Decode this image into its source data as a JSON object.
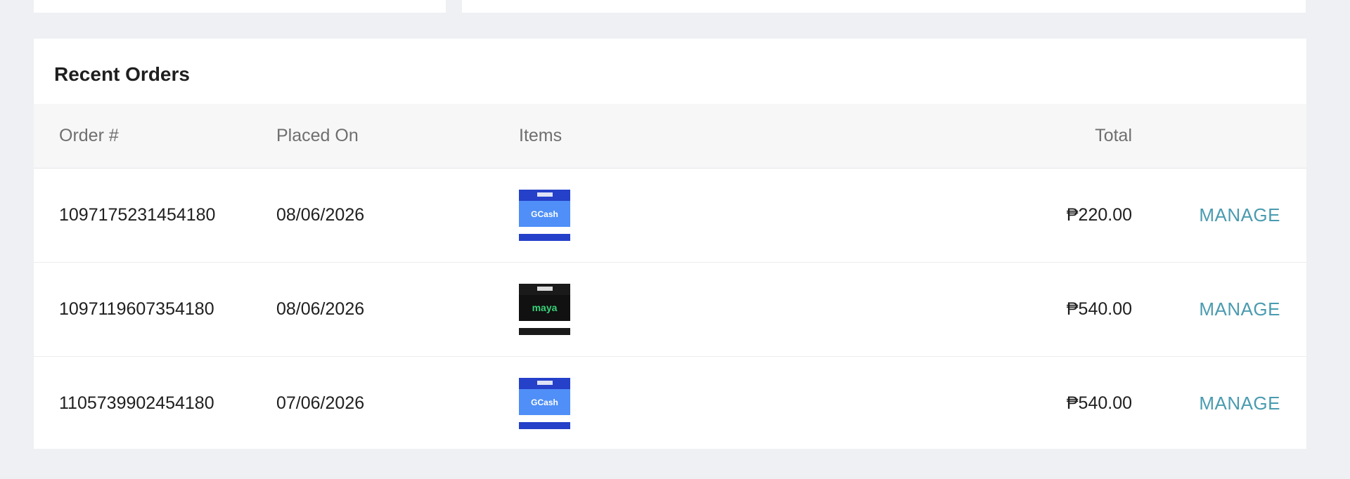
{
  "orders_card": {
    "title": "Recent Orders",
    "columns": {
      "order": "Order #",
      "placed_on": "Placed On",
      "items": "Items",
      "total": "Total"
    },
    "rows": [
      {
        "order_number": "1097175231454180",
        "placed_on": "08/06/2026",
        "item_brand": "GCash",
        "item_icon": "gcash-voucher-thumbnail",
        "total": "₱220.00",
        "action": "MANAGE"
      },
      {
        "order_number": "1097119607354180",
        "placed_on": "08/06/2026",
        "item_brand": "maya",
        "item_icon": "maya-voucher-thumbnail",
        "total": "₱540.00",
        "action": "MANAGE"
      },
      {
        "order_number": "1105739902454180",
        "placed_on": "07/06/2026",
        "item_brand": "GCash",
        "item_icon": "gcash-voucher-thumbnail",
        "total": "₱540.00",
        "action": "MANAGE"
      }
    ]
  },
  "colors": {
    "background": "#eff0f3",
    "link": "#4a9bb0",
    "gcash_blue": "#2540c9",
    "maya_green": "#38d37a"
  }
}
